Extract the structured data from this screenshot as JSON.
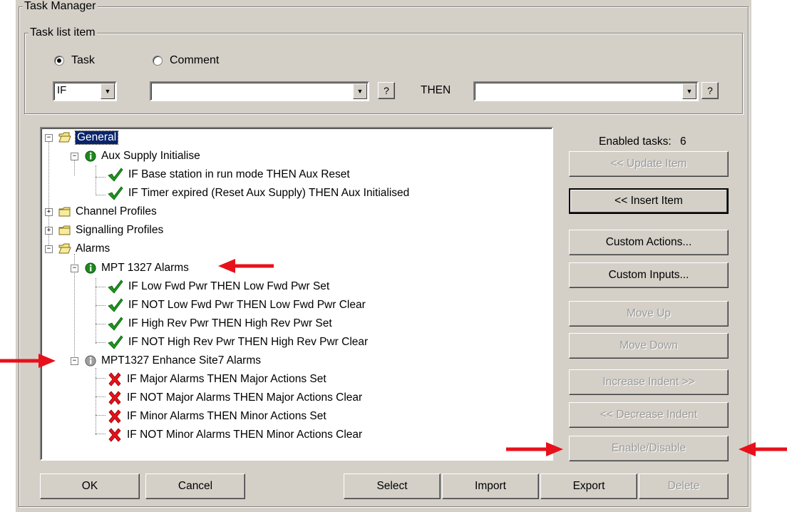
{
  "window": {
    "title": "Task Manager"
  },
  "task_list_item": {
    "legend": "Task list item",
    "radio_task": "Task",
    "radio_comment": "Comment",
    "condition_select": "IF",
    "input_select_value": "",
    "help_label": "?",
    "then_label": "THEN",
    "output_select_value": ""
  },
  "tree": {
    "general": "General",
    "aux_supply": "Aux Supply Initialise",
    "aux_task_1": "IF Base station in run mode THEN Aux Reset",
    "aux_task_2": "IF Timer expired (Reset Aux Supply) THEN Aux Initialised",
    "channel_profiles": "Channel Profiles",
    "signalling_profiles": "Signalling Profiles",
    "alarms": "Alarms",
    "mpt1327_alarms": "MPT 1327 Alarms",
    "mpt_task_1": "IF Low Fwd Pwr THEN Low Fwd Pwr Set",
    "mpt_task_2": "IF NOT Low Fwd Pwr THEN Low Fwd Pwr Clear",
    "mpt_task_3": "IF High Rev Pwr THEN High Rev Pwr Set",
    "mpt_task_4": "IF NOT High Rev Pwr THEN High Rev Pwr Clear",
    "enhance_site7": "MPT1327 Enhance Site7 Alarms",
    "site7_task_1": "IF Major Alarms THEN Major Actions Set",
    "site7_task_2": "IF NOT Major Alarms THEN Major Actions Clear",
    "site7_task_3": "IF Minor Alarms THEN Minor Actions Set",
    "site7_task_4": "IF NOT Minor Alarms THEN Minor Actions Clear"
  },
  "side": {
    "enabled_tasks_label": "Enabled tasks:",
    "enabled_tasks_count": "6",
    "update_item": "<< Update Item",
    "insert_item": "<< Insert Item",
    "custom_actions": "Custom Actions...",
    "custom_inputs": "Custom Inputs...",
    "move_up": "Move Up",
    "move_down": "Move Down",
    "increase_indent": "Increase Indent >>",
    "decrease_indent": "<< Decrease Indent",
    "enable_disable": "Enable/Disable"
  },
  "footer": {
    "ok": "OK",
    "cancel": "Cancel",
    "select": "Select",
    "import": "Import",
    "export": "Export",
    "delete": "Delete"
  },
  "colors": {
    "arrow": "#e8101a",
    "check": "#1a9a1a",
    "cross": "#e8101a",
    "selection": "#0a246a"
  }
}
